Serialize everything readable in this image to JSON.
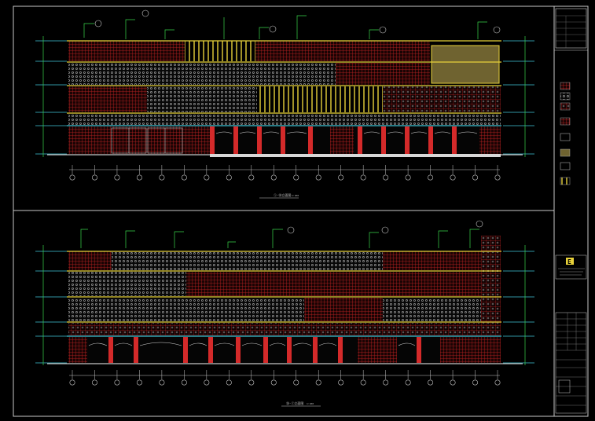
{
  "drawing": {
    "type": "CAD building elevation sheet",
    "background": "#000000",
    "line_colors": {
      "frame": "#c8c8c8",
      "facade_red": "#d42a2a",
      "facade_yellow": "#e8d23a",
      "cyan": "#3fc6d8",
      "green": "#39d64a",
      "white": "#e6e6e6",
      "tan_panel": "#8a7a3a"
    }
  },
  "elevations": [
    {
      "id": "upper",
      "title_text": "①-⑳立面图",
      "scale_text": "1:100"
    },
    {
      "id": "lower",
      "title_text": "⑳-①立面图",
      "scale_text": "1:100"
    }
  ],
  "title_block": {
    "logo_glyph": "Ε",
    "legend_swatches": 8
  }
}
